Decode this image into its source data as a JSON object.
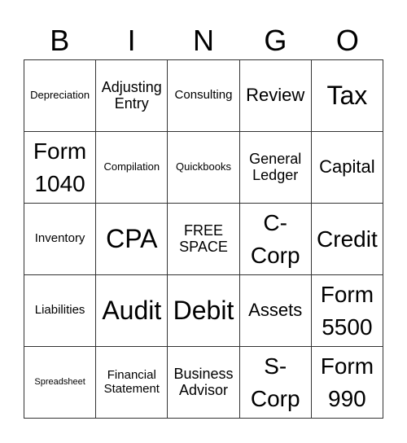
{
  "header": [
    "B",
    "I",
    "N",
    "G",
    "O"
  ],
  "cells": [
    {
      "text": "Depreciation",
      "size": "s-sm"
    },
    {
      "text": "Adjusting Entry",
      "size": "s-lg"
    },
    {
      "text": "Consulting",
      "size": "s-md"
    },
    {
      "text": "Review",
      "size": "s-xl"
    },
    {
      "text": "Tax",
      "size": "s-4xl"
    },
    {
      "text": "Form 1040",
      "size": "s-3xl"
    },
    {
      "text": "Compilation",
      "size": "s-sm"
    },
    {
      "text": "Quickbooks",
      "size": "s-sm"
    },
    {
      "text": "General Ledger",
      "size": "s-lg"
    },
    {
      "text": "Capital",
      "size": "s-xl"
    },
    {
      "text": "Inventory",
      "size": "s-md"
    },
    {
      "text": "CPA",
      "size": "s-4xl"
    },
    {
      "text": "FREE SPACE",
      "size": "s-lg"
    },
    {
      "text": "C-Corp",
      "size": "s-3xl"
    },
    {
      "text": "Credit",
      "size": "s-3xl"
    },
    {
      "text": "Liabilities",
      "size": "s-md"
    },
    {
      "text": "Audit",
      "size": "s-4xl"
    },
    {
      "text": "Debit",
      "size": "s-4xl"
    },
    {
      "text": "Assets",
      "size": "s-xl"
    },
    {
      "text": "Form 5500",
      "size": "s-3xl"
    },
    {
      "text": "Spreadsheet",
      "size": "s-xs"
    },
    {
      "text": "Financial Statement",
      "size": "s-md"
    },
    {
      "text": "Business Advisor",
      "size": "s-lg"
    },
    {
      "text": "S-Corp",
      "size": "s-3xl"
    },
    {
      "text": "Form 990",
      "size": "s-3xl"
    }
  ]
}
